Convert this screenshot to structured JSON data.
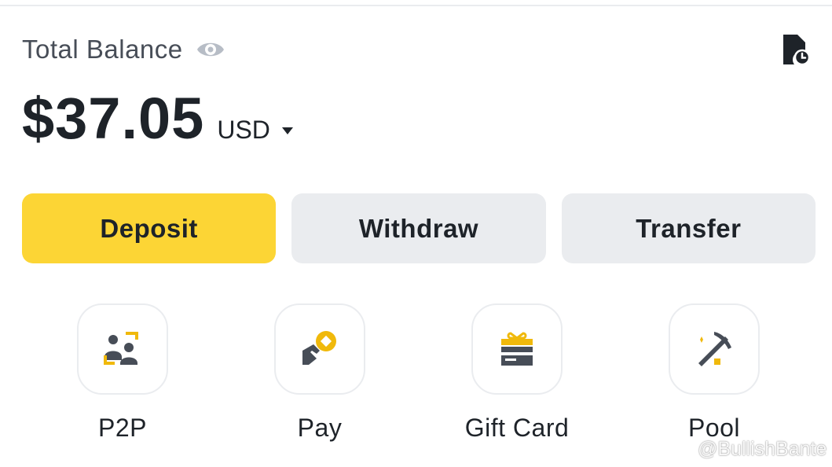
{
  "balance": {
    "title": "Total Balance",
    "amount": "$37.05",
    "currency": "USD",
    "icons": {
      "visibility": "eye-icon",
      "history": "history-icon",
      "currency_dropdown": "caret-down-icon"
    }
  },
  "actions": [
    {
      "label": "Deposit",
      "style": "primary"
    },
    {
      "label": "Withdraw",
      "style": "secondary"
    },
    {
      "label": "Transfer",
      "style": "secondary"
    }
  ],
  "shortcuts": [
    {
      "label": "P2P",
      "icon": "p2p-icon"
    },
    {
      "label": "Pay",
      "icon": "pay-icon"
    },
    {
      "label": "Gift Card",
      "icon": "gift-card-icon"
    },
    {
      "label": "Pool",
      "icon": "pickaxe-icon"
    }
  ],
  "watermark": {
    "text": "@BullishBante"
  },
  "colors": {
    "accent": "#FCD535",
    "text_primary": "#1E2329",
    "text_secondary": "#474D57",
    "button_secondary": "#EAECEF",
    "border": "#EAECEF"
  }
}
